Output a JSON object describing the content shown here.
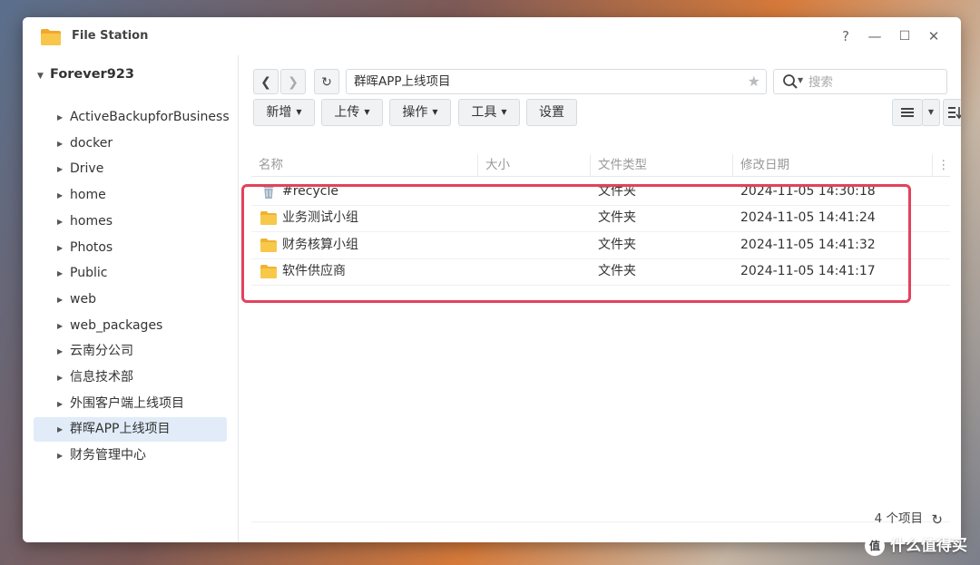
{
  "window": {
    "title": "File Station",
    "help": "?",
    "minimize": "—",
    "maximize": "☐",
    "close": "✕"
  },
  "sidebar": {
    "root": "Forever923",
    "items": [
      {
        "label": "ActiveBackupforBusiness"
      },
      {
        "label": "docker"
      },
      {
        "label": "Drive"
      },
      {
        "label": "home"
      },
      {
        "label": "homes"
      },
      {
        "label": "Photos"
      },
      {
        "label": "Public"
      },
      {
        "label": "web"
      },
      {
        "label": "web_packages"
      },
      {
        "label": "云南分公司"
      },
      {
        "label": "信息技术部"
      },
      {
        "label": "外围客户端上线项目"
      },
      {
        "label": "群晖APP上线项目",
        "selected": true
      },
      {
        "label": "财务管理中心"
      }
    ]
  },
  "toolbar": {
    "path": "群晖APP上线项目",
    "search_placeholder": "搜索",
    "buttons": {
      "new": "新增",
      "upload": "上传",
      "action": "操作",
      "tools": "工具",
      "settings": "设置"
    }
  },
  "grid": {
    "headers": {
      "name": "名称",
      "size": "大小",
      "type": "文件类型",
      "modified": "修改日期"
    },
    "rows": [
      {
        "name": "#recycle",
        "size": "",
        "type": "文件夹",
        "modified": "2024-11-05 14:30:18",
        "icon": "trash-icon"
      },
      {
        "name": "业务测试小组",
        "size": "",
        "type": "文件夹",
        "modified": "2024-11-05 14:41:24",
        "icon": "folder-icon"
      },
      {
        "name": "财务核算小组",
        "size": "",
        "type": "文件夹",
        "modified": "2024-11-05 14:41:32",
        "icon": "folder-icon"
      },
      {
        "name": "软件供应商",
        "size": "",
        "type": "文件夹",
        "modified": "2024-11-05 14:41:17",
        "icon": "folder-icon"
      }
    ]
  },
  "status": {
    "count": "4 个项目"
  },
  "watermark": {
    "logo": "值",
    "text": "什么值得买"
  },
  "colors": {
    "highlight": "#e2425b",
    "selected_bg": "#e1ecf8",
    "folder": "#f5c342"
  }
}
